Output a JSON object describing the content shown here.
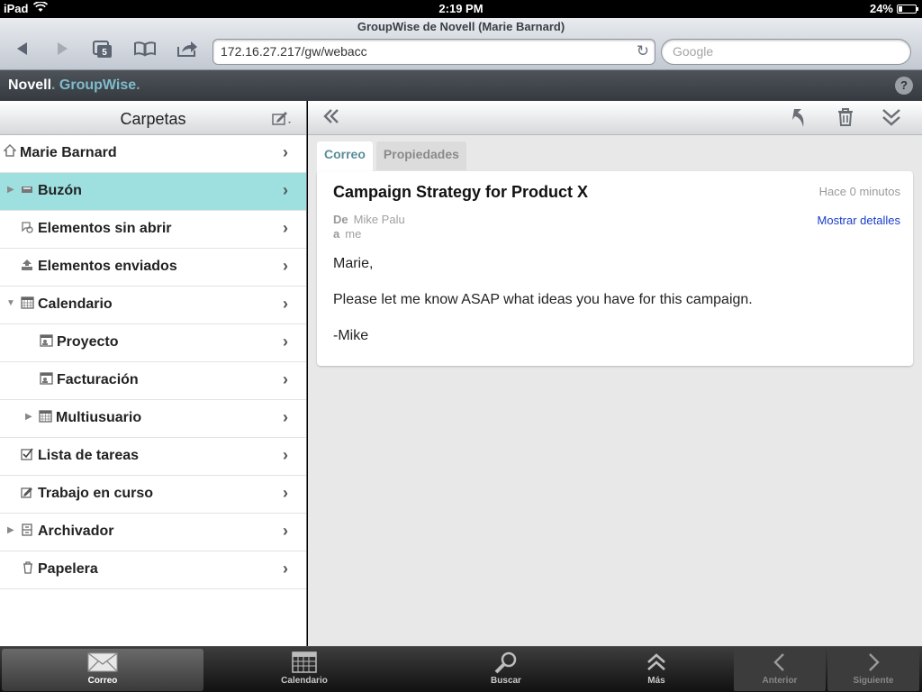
{
  "status_bar": {
    "device": "iPad",
    "time": "2:19 PM",
    "battery": "24%",
    "battery_level": 0.24
  },
  "safari": {
    "page_title": "GroupWise de Novell (Marie Barnard)",
    "tab_count": "5",
    "url": "172.16.27.217/gw/webacc",
    "search_placeholder": "Google"
  },
  "header": {
    "brand_primary": "Novell",
    "brand_secondary": "GroupWise",
    "help": "?"
  },
  "folders_panel": {
    "title": "Carpetas",
    "items": [
      {
        "label": "Marie Barnard",
        "icon": "home-icon"
      },
      {
        "label": "Buzón",
        "icon": "inbox-icon",
        "selected": true
      },
      {
        "label": "Elementos sin abrir",
        "icon": "unopened-icon"
      },
      {
        "label": "Elementos enviados",
        "icon": "sent-icon"
      },
      {
        "label": "Calendario",
        "icon": "calendar-icon"
      },
      {
        "label": "Proyecto",
        "icon": "shared-calendar-icon"
      },
      {
        "label": "Facturación",
        "icon": "shared-calendar-icon"
      },
      {
        "label": "Multiusuario",
        "icon": "calendar-icon"
      },
      {
        "label": "Lista de tareas",
        "icon": "checklist-icon"
      },
      {
        "label": "Trabajo en curso",
        "icon": "work-in-progress-icon"
      },
      {
        "label": "Archivador",
        "icon": "cabinet-icon"
      },
      {
        "label": "Papelera",
        "icon": "trash-icon"
      }
    ]
  },
  "message": {
    "tabs": [
      "Correo",
      "Propiedades"
    ],
    "subject": "Campaign Strategy for Product X",
    "age": "Hace 0 minutos",
    "from_label": "De",
    "from": "Mike Palu",
    "to_label": "a",
    "to": "me",
    "details_link": "Mostrar detalles",
    "body": [
      "Marie,",
      "Please let me know ASAP what ideas you have for this campaign.",
      "-Mike"
    ]
  },
  "tab_bar": {
    "items": [
      {
        "label": "Correo"
      },
      {
        "label": "Calendario"
      },
      {
        "label": "Buscar"
      },
      {
        "label": "Más"
      },
      {
        "label": "Anterior"
      },
      {
        "label": "Siguiente"
      }
    ]
  }
}
